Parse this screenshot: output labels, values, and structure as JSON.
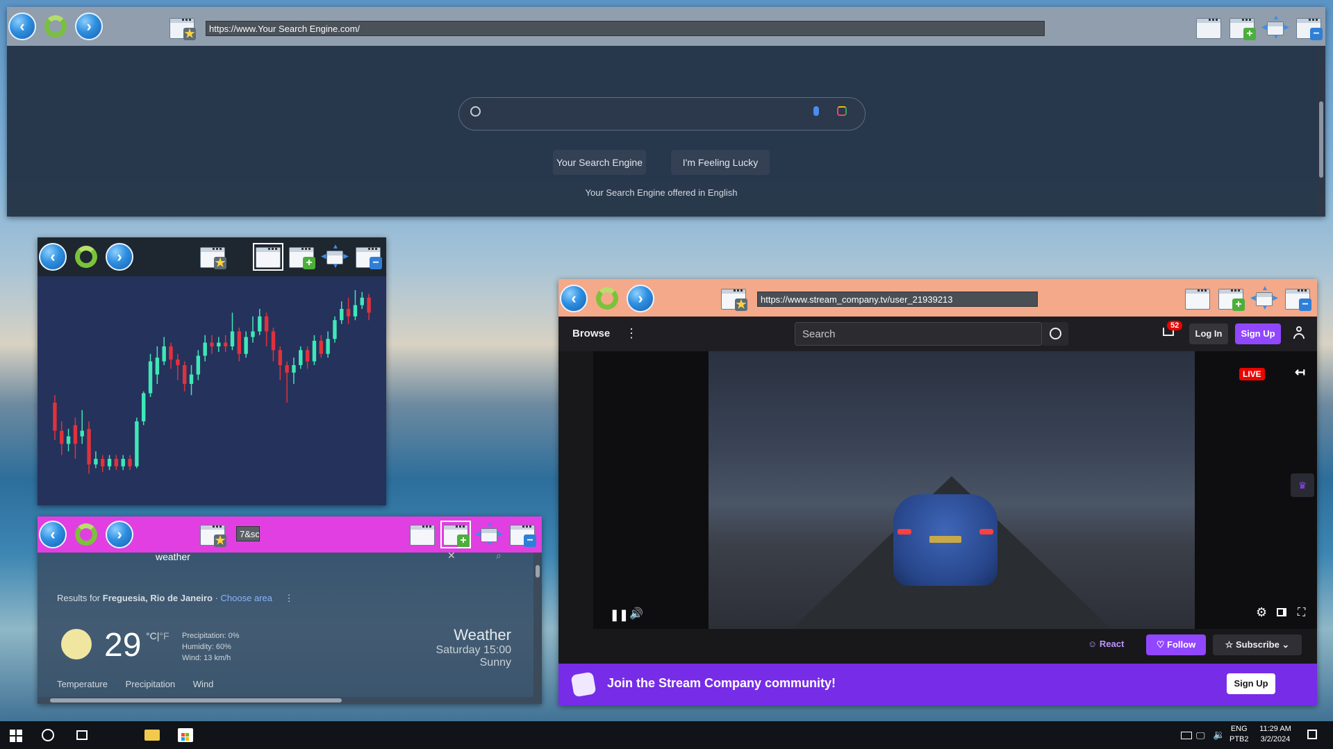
{
  "browser_top": {
    "url": "https://www.Your Search Engine.com/",
    "search_button": "Your Search Engine",
    "lucky_button": "I'm Feeling Lucky",
    "offered_text": "Your Search Engine offered in English"
  },
  "weather_window": {
    "url_fragment": "7&sc",
    "search_query": "weather",
    "results_prefix": "Results for ",
    "location": "Freguesia, Rio de Janeiro",
    "choose_area": "Choose area",
    "temperature": "29",
    "unit_c": "°C",
    "unit_sep": "|",
    "unit_f": "°F",
    "precipitation": "Precipitation: 0%",
    "humidity": "Humidity: 60%",
    "wind": "Wind: 13 km/h",
    "title": "Weather",
    "day_time": "Saturday 15:00",
    "condition": "Sunny",
    "tabs": [
      "Temperature",
      "Precipitation",
      "Wind"
    ]
  },
  "stream_window": {
    "url": "https://www.stream_company.tv/user_21939213",
    "browse": "Browse",
    "search_placeholder": "Search",
    "notification_count": "52",
    "login": "Log In",
    "signup": "Sign Up",
    "live_badge": "LIVE",
    "react": "React",
    "follow": "Follow",
    "subscribe": "Subscribe",
    "banner_text": "Join the Stream Company community!",
    "banner_signup": "Sign Up"
  },
  "chart_data": {
    "type": "candlestick",
    "title": "",
    "candles": [
      {
        "o": 0.4,
        "c": 0.25,
        "h": 0.44,
        "l": 0.2
      },
      {
        "o": 0.25,
        "c": 0.18,
        "h": 0.3,
        "l": 0.12
      },
      {
        "o": 0.18,
        "c": 0.22,
        "h": 0.26,
        "l": 0.14
      },
      {
        "o": 0.28,
        "c": 0.18,
        "h": 0.32,
        "l": 0.1
      },
      {
        "o": 0.22,
        "c": 0.25,
        "h": 0.36,
        "l": 0.18
      },
      {
        "o": 0.26,
        "c": 0.07,
        "h": 0.3,
        "l": 0.02
      },
      {
        "o": 0.07,
        "c": 0.1,
        "h": 0.14,
        "l": 0.05
      },
      {
        "o": 0.1,
        "c": 0.06,
        "h": 0.12,
        "l": 0.03
      },
      {
        "o": 0.06,
        "c": 0.1,
        "h": 0.12,
        "l": 0.04
      },
      {
        "o": 0.1,
        "c": 0.06,
        "h": 0.12,
        "l": 0.04
      },
      {
        "o": 0.06,
        "c": 0.1,
        "h": 0.12,
        "l": 0.04
      },
      {
        "o": 0.1,
        "c": 0.06,
        "h": 0.12,
        "l": 0.04
      },
      {
        "o": 0.06,
        "c": 0.3,
        "h": 0.32,
        "l": 0.05
      },
      {
        "o": 0.3,
        "c": 0.45,
        "h": 0.46,
        "l": 0.28
      },
      {
        "o": 0.45,
        "c": 0.62,
        "h": 0.66,
        "l": 0.43
      },
      {
        "o": 0.55,
        "c": 0.64,
        "h": 0.7,
        "l": 0.5
      },
      {
        "o": 0.62,
        "c": 0.7,
        "h": 0.75,
        "l": 0.6
      },
      {
        "o": 0.7,
        "c": 0.63,
        "h": 0.72,
        "l": 0.58
      },
      {
        "o": 0.63,
        "c": 0.6,
        "h": 0.66,
        "l": 0.52
      },
      {
        "o": 0.6,
        "c": 0.5,
        "h": 0.62,
        "l": 0.46
      },
      {
        "o": 0.5,
        "c": 0.55,
        "h": 0.6,
        "l": 0.44
      },
      {
        "o": 0.55,
        "c": 0.65,
        "h": 0.68,
        "l": 0.52
      },
      {
        "o": 0.65,
        "c": 0.72,
        "h": 0.76,
        "l": 0.62
      },
      {
        "o": 0.72,
        "c": 0.7,
        "h": 0.76,
        "l": 0.66
      },
      {
        "o": 0.7,
        "c": 0.72,
        "h": 0.75,
        "l": 0.67
      },
      {
        "o": 0.72,
        "c": 0.7,
        "h": 0.76,
        "l": 0.67
      },
      {
        "o": 0.7,
        "c": 0.78,
        "h": 0.88,
        "l": 0.68
      },
      {
        "o": 0.78,
        "c": 0.66,
        "h": 0.8,
        "l": 0.62
      },
      {
        "o": 0.66,
        "c": 0.75,
        "h": 0.78,
        "l": 0.64
      },
      {
        "o": 0.75,
        "c": 0.78,
        "h": 0.86,
        "l": 0.72
      },
      {
        "o": 0.78,
        "c": 0.86,
        "h": 0.9,
        "l": 0.76
      },
      {
        "o": 0.86,
        "c": 0.78,
        "h": 0.88,
        "l": 0.7
      },
      {
        "o": 0.78,
        "c": 0.68,
        "h": 0.8,
        "l": 0.62
      },
      {
        "o": 0.68,
        "c": 0.6,
        "h": 0.7,
        "l": 0.52
      },
      {
        "o": 0.6,
        "c": 0.56,
        "h": 0.62,
        "l": 0.4
      },
      {
        "o": 0.56,
        "c": 0.6,
        "h": 0.64,
        "l": 0.5
      },
      {
        "o": 0.6,
        "c": 0.68,
        "h": 0.7,
        "l": 0.58
      },
      {
        "o": 0.68,
        "c": 0.62,
        "h": 0.7,
        "l": 0.58
      },
      {
        "o": 0.62,
        "c": 0.73,
        "h": 0.76,
        "l": 0.6
      },
      {
        "o": 0.73,
        "c": 0.66,
        "h": 0.76,
        "l": 0.64
      },
      {
        "o": 0.66,
        "c": 0.74,
        "h": 0.78,
        "l": 0.64
      },
      {
        "o": 0.74,
        "c": 0.84,
        "h": 0.86,
        "l": 0.72
      },
      {
        "o": 0.84,
        "c": 0.9,
        "h": 0.94,
        "l": 0.82
      },
      {
        "o": 0.9,
        "c": 0.86,
        "h": 0.96,
        "l": 0.82
      },
      {
        "o": 0.86,
        "c": 0.92,
        "h": 1.0,
        "l": 0.84
      },
      {
        "o": 0.92,
        "c": 0.96,
        "h": 0.99,
        "l": 0.9
      },
      {
        "o": 0.96,
        "c": 0.88,
        "h": 0.98,
        "l": 0.84
      }
    ],
    "up_color": "#3ee8b8",
    "down_color": "#e0323c"
  },
  "taskbar": {
    "lang_top": "ENG",
    "lang_bottom": "PTB2",
    "time": "11:29 AM",
    "date": "3/2/2024"
  },
  "colors": {
    "stream_purple": "#9147ff",
    "live_red": "#eb0400",
    "weather_titlebar": "#e13fe1",
    "stream_titlebar": "#f4a98a"
  }
}
